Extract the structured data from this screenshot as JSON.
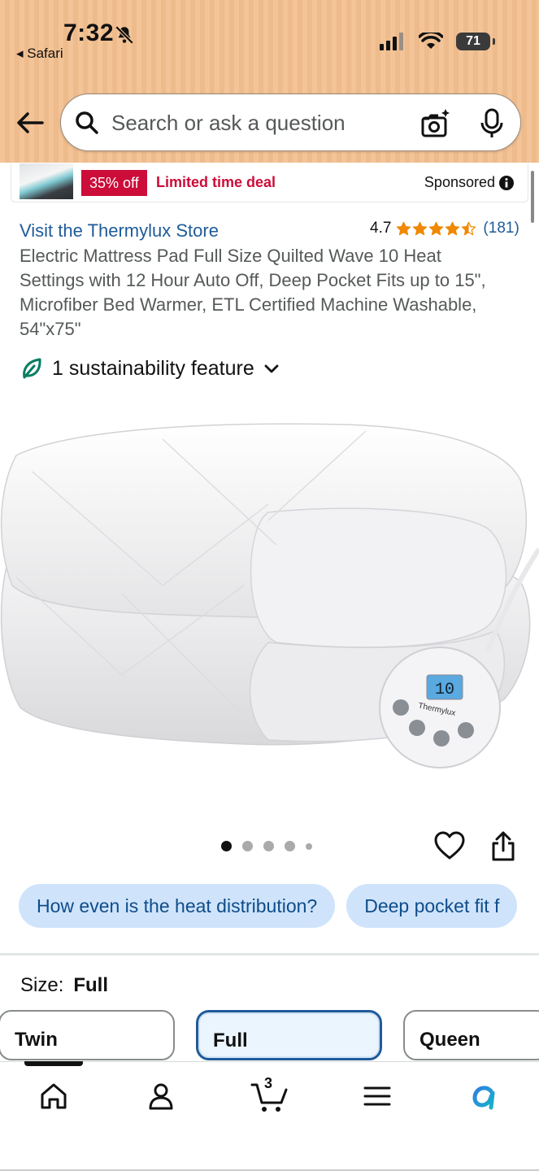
{
  "status_bar": {
    "time": "7:32",
    "back_app": "Safari",
    "battery": "71"
  },
  "search": {
    "placeholder": "Search or ask a question"
  },
  "sponsored": {
    "discount": "35% off",
    "deal": "Limited time deal",
    "label": "Sponsored"
  },
  "product": {
    "store_link": "Visit the Thermylux Store",
    "rating": "4.7",
    "stars": 4.5,
    "review_count": "(181)",
    "title": "Electric Mattress Pad Full Size Quilted Wave 10 Heat Settings with 12 Hour Auto Off, Deep Pocket Fits up to 15\", Microfiber Bed Warmer, ETL Certified Machine Washable, 54\"x75\"",
    "sustainability": "1 sustainability feature",
    "image_brand": "Thermylux",
    "controller_display": "10",
    "image_count": 5,
    "image_index": 1
  },
  "questions": [
    "How even is the heat distribution?",
    "Deep pocket fit f"
  ],
  "size": {
    "label": "Size:",
    "value": "Full",
    "options": [
      "Twin",
      "Full",
      "Queen"
    ],
    "selected": "Full"
  },
  "nav": {
    "cart_count": "3",
    "items": [
      "home-icon",
      "account-icon",
      "cart-icon",
      "menu-icon",
      "rufus-icon"
    ],
    "active": "home-icon"
  },
  "colors": {
    "link": "#1f5b99",
    "deal_red": "#cc0c39",
    "star": "#f08804",
    "chip_bg": "#cfe4fb",
    "leaf": "#067d62"
  }
}
